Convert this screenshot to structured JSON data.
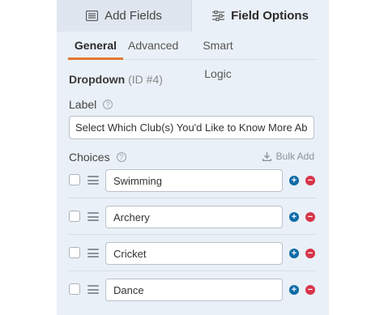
{
  "top_tabs": {
    "add_fields": {
      "label": "Add Fields",
      "icon": "list-icon"
    },
    "field_options": {
      "label": "Field Options",
      "icon": "sliders-icon"
    }
  },
  "sub_tabs": [
    {
      "label": "General",
      "active": true
    },
    {
      "label": "Advanced",
      "active": false
    },
    {
      "label": "Smart Logic",
      "active": false
    }
  ],
  "field": {
    "name": "Dropdown",
    "id_text": "(ID #4)"
  },
  "label_section": {
    "title": "Label",
    "help": "?",
    "value": "Select Which Club(s) You'd Like to Know More About"
  },
  "choices_section": {
    "title": "Choices",
    "help": "?",
    "bulk_add": "Bulk Add"
  },
  "choices": [
    {
      "value": "Swimming"
    },
    {
      "value": "Archery"
    },
    {
      "value": "Cricket"
    },
    {
      "value": "Dance"
    }
  ],
  "colors": {
    "accent": "#e27730",
    "add": "#0e6ba8",
    "remove": "#d6354a",
    "panel_bg": "#eaf0f7"
  }
}
